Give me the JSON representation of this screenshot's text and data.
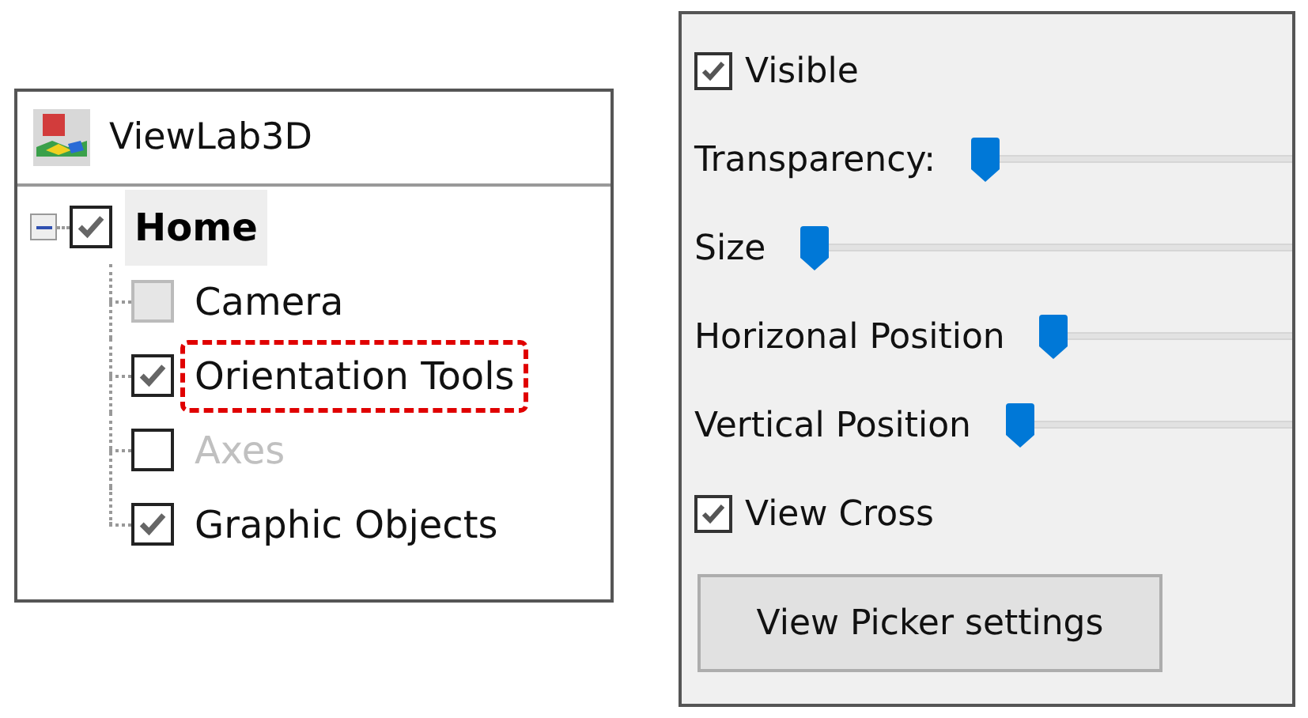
{
  "tree_panel": {
    "title": "ViewLab3D",
    "root": {
      "label": "Home",
      "expanded": true,
      "checked": true,
      "selected": true,
      "children": [
        {
          "label": "Camera",
          "checked": false,
          "disabled": true,
          "text_greyed": false,
          "highlighted": false
        },
        {
          "label": "Orientation Tools",
          "checked": true,
          "disabled": false,
          "text_greyed": false,
          "highlighted": true
        },
        {
          "label": "Axes",
          "checked": false,
          "disabled": false,
          "text_greyed": true,
          "highlighted": false
        },
        {
          "label": "Graphic Objects",
          "checked": true,
          "disabled": false,
          "text_greyed": false,
          "highlighted": false
        }
      ]
    }
  },
  "settings_panel": {
    "rows": [
      {
        "kind": "checkbox",
        "label": "Visible",
        "checked": true
      },
      {
        "kind": "slider",
        "label": "Transparency:",
        "level": 0
      },
      {
        "kind": "slider",
        "label": "Size",
        "level": 0
      },
      {
        "kind": "slider",
        "label": "Horizonal Position",
        "level": 0
      },
      {
        "kind": "slider",
        "label": "Vertical Position",
        "level": 0
      },
      {
        "kind": "checkbox",
        "label": "View Cross",
        "checked": true
      },
      {
        "kind": "button",
        "label": "View Picker settings"
      }
    ]
  }
}
